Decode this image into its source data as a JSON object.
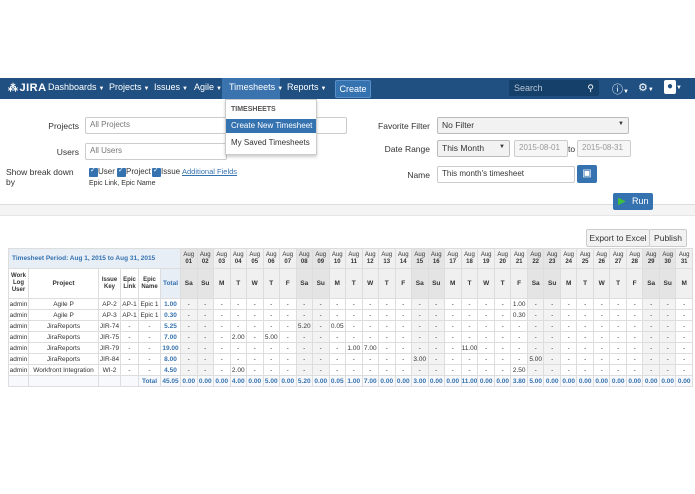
{
  "nav": {
    "logo": "JIRA",
    "items": [
      "Dashboards",
      "Projects",
      "Issues",
      "Agile",
      "Timesheets",
      "Reports"
    ],
    "create": "Create",
    "search_placeholder": "Search"
  },
  "dropdown": {
    "heading": "TIMESHEETS",
    "items": [
      "Create New Timesheet",
      "My Saved Timesheets"
    ]
  },
  "form": {
    "projects_label": "Projects",
    "projects_placeholder": "All Projects",
    "users_label": "Users",
    "users_placeholder": "All Users",
    "breakdown_label": "Show break down by",
    "breakdown_options": [
      "User",
      "Project",
      "Issue"
    ],
    "additional_fields_link": "Additional Fields",
    "additional_fields_value": "Epic Link, Epic Name",
    "favorite_filter_label": "Favorite Filter",
    "favorite_filter_value": "No Filter",
    "date_range_label": "Date Range",
    "date_range_value": "This Month",
    "date_from": "2015-08-01",
    "date_to_sep": "to",
    "date_to": "2015-08-31",
    "name_label": "Name",
    "name_value": "This month's timesheet",
    "run_label": "Run"
  },
  "toolbar": {
    "export_label": "Export to Excel",
    "publish_label": "Publish"
  },
  "table": {
    "period": "Timesheet Period: Aug 1, 2015 to Aug 31, 2015",
    "columns": [
      "Work Log User",
      "Project",
      "Issue Key",
      "Epic Link",
      "Epic Name",
      "Total"
    ],
    "month": "Aug",
    "days": [
      "01",
      "02",
      "03",
      "04",
      "05",
      "06",
      "07",
      "08",
      "09",
      "10",
      "11",
      "12",
      "13",
      "14",
      "15",
      "16",
      "17",
      "18",
      "19",
      "20",
      "21",
      "22",
      "23",
      "24",
      "25",
      "26",
      "27",
      "28",
      "29",
      "30",
      "31"
    ],
    "dow": [
      "Sa",
      "Su",
      "M",
      "T",
      "W",
      "T",
      "F",
      "Sa",
      "Su",
      "M",
      "T",
      "W",
      "T",
      "F",
      "Sa",
      "Su",
      "M",
      "T",
      "W",
      "T",
      "F",
      "Sa",
      "Su",
      "M",
      "T",
      "W",
      "T",
      "F",
      "Sa",
      "Su",
      "M"
    ],
    "rows": [
      {
        "user": "admin",
        "project": "Agile P",
        "issue": "AP-2",
        "epic_link": "AP-1",
        "epic_name": "Epic 1",
        "total": "1.00",
        "cells": [
          "-",
          "-",
          "-",
          "-",
          "-",
          "-",
          "-",
          "-",
          "-",
          "-",
          "-",
          "-",
          "-",
          "-",
          "-",
          "-",
          "-",
          "-",
          "-",
          "-",
          "1.00",
          "-",
          "-",
          "-",
          "-",
          "-",
          "-",
          "-",
          "-",
          "-",
          "-"
        ]
      },
      {
        "user": "admin",
        "project": "Agile P",
        "issue": "AP-3",
        "epic_link": "AP-1",
        "epic_name": "Epic 1",
        "total": "0.30",
        "cells": [
          "-",
          "-",
          "-",
          "-",
          "-",
          "-",
          "-",
          "-",
          "-",
          "-",
          "-",
          "-",
          "-",
          "-",
          "-",
          "-",
          "-",
          "-",
          "-",
          "-",
          "0.30",
          "-",
          "-",
          "-",
          "-",
          "-",
          "-",
          "-",
          "-",
          "-",
          "-"
        ]
      },
      {
        "user": "admin",
        "project": "JiraReports",
        "issue": "JIR-74",
        "epic_link": "-",
        "epic_name": "-",
        "total": "5.25",
        "cells": [
          "-",
          "-",
          "-",
          "-",
          "-",
          "-",
          "-",
          "5.20",
          "-",
          "0.05",
          "-",
          "-",
          "-",
          "-",
          "-",
          "-",
          "-",
          "-",
          "-",
          "-",
          "-",
          "-",
          "-",
          "-",
          "-",
          "-",
          "-",
          "-",
          "-",
          "-",
          "-"
        ]
      },
      {
        "user": "admin",
        "project": "JiraReports",
        "issue": "JIR-75",
        "epic_link": "-",
        "epic_name": "-",
        "total": "7.00",
        "cells": [
          "-",
          "-",
          "-",
          "2.00",
          "-",
          "5.00",
          "-",
          "-",
          "-",
          "-",
          "-",
          "-",
          "-",
          "-",
          "-",
          "-",
          "-",
          "-",
          "-",
          "-",
          "-",
          "-",
          "-",
          "-",
          "-",
          "-",
          "-",
          "-",
          "-",
          "-",
          "-"
        ]
      },
      {
        "user": "admin",
        "project": "JiraReports",
        "issue": "JIR-79",
        "epic_link": "-",
        "epic_name": "-",
        "total": "19.00",
        "cells": [
          "-",
          "-",
          "-",
          "-",
          "-",
          "-",
          "-",
          "-",
          "-",
          "-",
          "1.00",
          "7.00",
          "-",
          "-",
          "-",
          "-",
          "-",
          "11.00",
          "-",
          "-",
          "-",
          "-",
          "-",
          "-",
          "-",
          "-",
          "-",
          "-",
          "-",
          "-",
          "-"
        ]
      },
      {
        "user": "admin",
        "project": "JiraReports",
        "issue": "JIR-84",
        "epic_link": "-",
        "epic_name": "-",
        "total": "8.00",
        "cells": [
          "-",
          "-",
          "-",
          "-",
          "-",
          "-",
          "-",
          "-",
          "-",
          "-",
          "-",
          "-",
          "-",
          "-",
          "3.00",
          "-",
          "-",
          "-",
          "-",
          "-",
          "-",
          "5.00",
          "-",
          "-",
          "-",
          "-",
          "-",
          "-",
          "-",
          "-",
          "-"
        ]
      },
      {
        "user": "admin",
        "project": "Workfront Integration",
        "issue": "WI-2",
        "epic_link": "-",
        "epic_name": "-",
        "total": "4.50",
        "cells": [
          "-",
          "-",
          "-",
          "2.00",
          "-",
          "-",
          "-",
          "-",
          "-",
          "-",
          "-",
          "-",
          "-",
          "-",
          "-",
          "-",
          "-",
          "-",
          "-",
          "-",
          "2.50",
          "-",
          "-",
          "-",
          "-",
          "-",
          "-",
          "-",
          "-",
          "-",
          "-"
        ]
      }
    ],
    "total_label": "Total",
    "grand_total": "45.05",
    "day_totals": [
      "0.00",
      "0.00",
      "0.00",
      "4.00",
      "0.00",
      "5.00",
      "0.00",
      "5.20",
      "0.00",
      "0.05",
      "1.00",
      "7.00",
      "0.00",
      "0.00",
      "3.00",
      "0.00",
      "0.00",
      "11.00",
      "0.00",
      "0.00",
      "3.80",
      "5.00",
      "0.00",
      "0.00",
      "0.00",
      "0.00",
      "0.00",
      "0.00",
      "0.00",
      "0.00",
      "0.00"
    ]
  }
}
